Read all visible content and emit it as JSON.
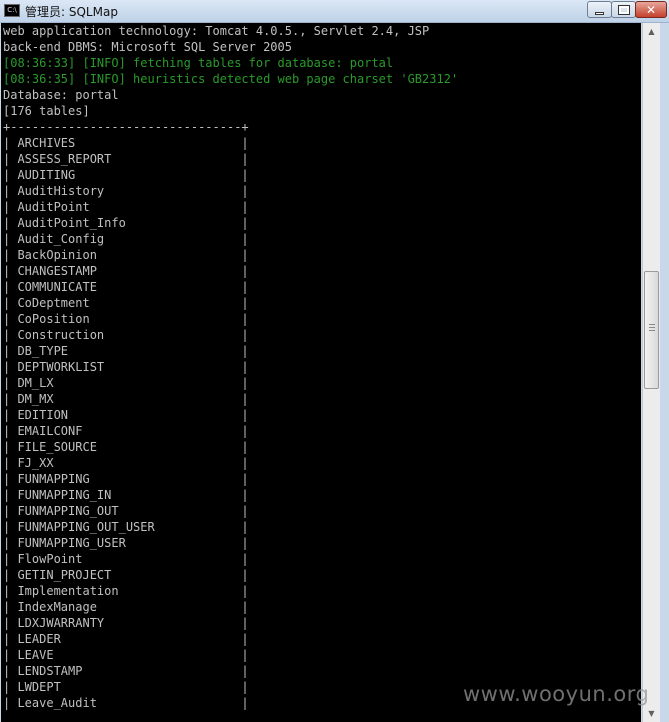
{
  "window": {
    "title": "管理员: SQLMap",
    "icon_text": "C:\\",
    "controls": {
      "minimize": "minimize-icon",
      "maximize": "maximize-icon",
      "close": "close-icon"
    }
  },
  "console": {
    "lines": [
      {
        "text": "web application technology: Tomcat 4.0.5., Servlet 2.4, JSP",
        "style": "normal"
      },
      {
        "text": "back-end DBMS: Microsoft SQL Server 2005",
        "style": "normal"
      },
      {
        "text": "[08:36:33] [INFO] fetching tables for database: portal",
        "style": "info"
      },
      {
        "text": "[08:36:35] [INFO] heuristics detected web page charset 'GB2312'",
        "style": "info"
      },
      {
        "text": "Database: portal",
        "style": "normal"
      },
      {
        "text": "[176 tables]",
        "style": "normal"
      },
      {
        "text": "+--------------------------------+",
        "style": "normal"
      },
      {
        "text": "| ARCHIVES                       |",
        "style": "normal"
      },
      {
        "text": "| ASSESS_REPORT                  |",
        "style": "normal"
      },
      {
        "text": "| AUDITING                       |",
        "style": "normal"
      },
      {
        "text": "| AuditHistory                   |",
        "style": "normal"
      },
      {
        "text": "| AuditPoint                     |",
        "style": "normal"
      },
      {
        "text": "| AuditPoint_Info                |",
        "style": "normal"
      },
      {
        "text": "| Audit_Config                   |",
        "style": "normal"
      },
      {
        "text": "| BackOpinion                    |",
        "style": "normal"
      },
      {
        "text": "| CHANGESTAMP                    |",
        "style": "normal"
      },
      {
        "text": "| COMMUNICATE                    |",
        "style": "normal"
      },
      {
        "text": "| CoDeptment                     |",
        "style": "normal"
      },
      {
        "text": "| CoPosition                     |",
        "style": "normal"
      },
      {
        "text": "| Construction                   |",
        "style": "normal"
      },
      {
        "text": "| DB_TYPE                        |",
        "style": "normal"
      },
      {
        "text": "| DEPTWORKLIST                   |",
        "style": "normal"
      },
      {
        "text": "| DM_LX                          |",
        "style": "normal"
      },
      {
        "text": "| DM_MX                          |",
        "style": "normal"
      },
      {
        "text": "| EDITION                        |",
        "style": "normal"
      },
      {
        "text": "| EMAILCONF                      |",
        "style": "normal"
      },
      {
        "text": "| FILE_SOURCE                    |",
        "style": "normal"
      },
      {
        "text": "| FJ_XX                          |",
        "style": "normal"
      },
      {
        "text": "| FUNMAPPING                     |",
        "style": "normal"
      },
      {
        "text": "| FUNMAPPING_IN                  |",
        "style": "normal"
      },
      {
        "text": "| FUNMAPPING_OUT                 |",
        "style": "normal"
      },
      {
        "text": "| FUNMAPPING_OUT_USER            |",
        "style": "normal"
      },
      {
        "text": "| FUNMAPPING_USER                |",
        "style": "normal"
      },
      {
        "text": "| FlowPoint                      |",
        "style": "normal"
      },
      {
        "text": "| GETIN_PROJECT                  |",
        "style": "normal"
      },
      {
        "text": "| Implementation                 |",
        "style": "normal"
      },
      {
        "text": "| IndexManage                    |",
        "style": "normal"
      },
      {
        "text": "| LDXJWARRANTY                   |",
        "style": "normal"
      },
      {
        "text": "| LEADER                         |",
        "style": "normal"
      },
      {
        "text": "| LEAVE                          |",
        "style": "normal"
      },
      {
        "text": "| LENDSTAMP                      |",
        "style": "normal"
      },
      {
        "text": "| LWDEPT                         |",
        "style": "normal"
      },
      {
        "text": "| Leave_Audit                    |",
        "style": "normal"
      }
    ]
  },
  "watermark": {
    "text": "www.wooyun.org"
  },
  "colors": {
    "console_bg": "#000000",
    "text": "#c0c0c0",
    "info": "#2a9a2a",
    "frame": "#c8d8ea"
  }
}
